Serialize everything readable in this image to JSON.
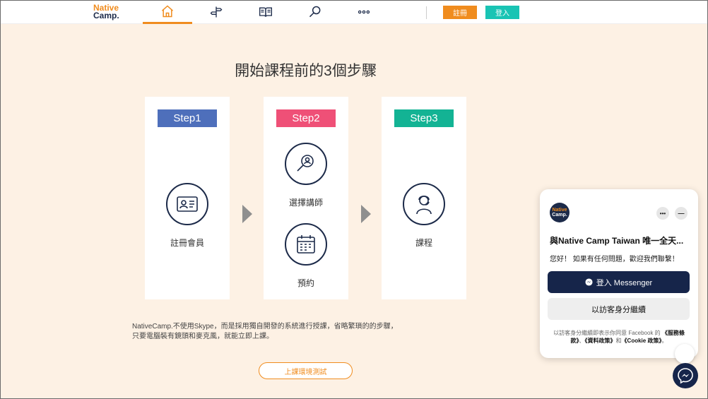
{
  "header": {
    "logo_line1": "Native",
    "logo_line2": "Camp.",
    "nav": [
      {
        "icon": "home-icon",
        "active": true
      },
      {
        "icon": "signpost-icon",
        "active": false
      },
      {
        "icon": "book-icon",
        "active": false
      },
      {
        "icon": "search-icon",
        "active": false
      },
      {
        "icon": "more-icon",
        "active": false
      }
    ],
    "register_label": "註冊",
    "login_label": "登入"
  },
  "main": {
    "title": "開始課程前的3個步驟",
    "steps": [
      {
        "tag": "Step1",
        "color": "#4e6fbb",
        "items": [
          {
            "icon": "id-card-icon",
            "label": "註冊會員"
          }
        ]
      },
      {
        "tag": "Step2",
        "color": "#ef5077",
        "items": [
          {
            "icon": "teacher-search-icon",
            "label": "選擇講師"
          },
          {
            "icon": "calendar-icon",
            "label": "預約"
          }
        ]
      },
      {
        "tag": "Step3",
        "color": "#13b394",
        "items": [
          {
            "icon": "student-headset-icon",
            "label": "課程"
          }
        ]
      }
    ],
    "description_line1": "NativeCamp.不使用Skype，而是採用獨自開發的系統進行授課，省略繁瑣的的步驟，",
    "description_line2": "只要電腦裝有鏡頭和麥克風，就能立即上課。",
    "test_button": "上課環境測試"
  },
  "chat": {
    "avatar_line1": "Native",
    "avatar_line2": "Camp.",
    "more_label": "•••",
    "minimize_label": "—",
    "title": "與Native Camp Taiwan 唯一全天...",
    "greeting": "您好！ 如果有任何問題，歡迎我們聯繫！",
    "messenger_button": "登入 Messenger",
    "guest_button": "以訪客身分繼續",
    "legal_prefix": "以訪客身分繼續即表示你同意 Facebook 的",
    "legal_terms": "《服務條款》",
    "legal_sep": "、",
    "legal_data": "《資料政策》",
    "legal_and": "和",
    "legal_cookie": "《Cookie 政策》",
    "legal_end": "。"
  },
  "colors": {
    "accent_orange": "#f08c1e",
    "teal": "#19c4b4",
    "navy": "#1c2a49",
    "background": "#fdf1e4"
  }
}
